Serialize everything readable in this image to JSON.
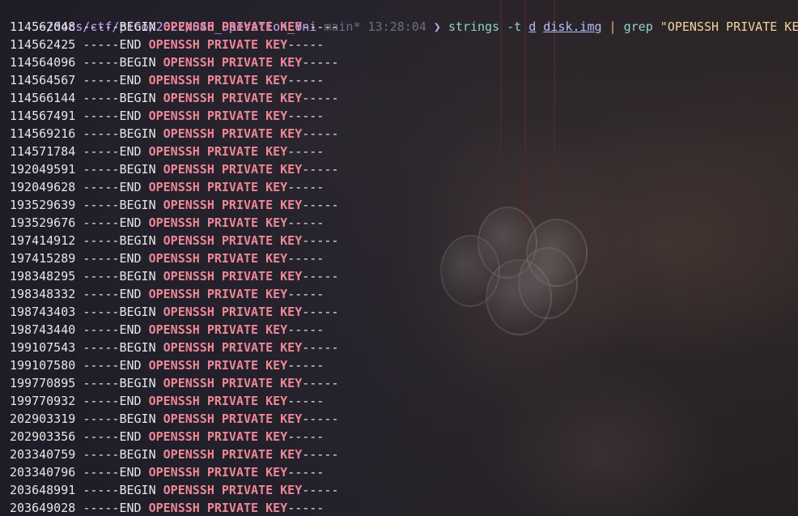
{
  "prompt": {
    "path": "~/docs/ctf/pico/2022/046_Operation_Oni",
    "branch": "main*",
    "time": "13:28:04",
    "chevron": "❯",
    "command": "strings",
    "flag": "-t",
    "flag_arg": "d",
    "file": "disk.img",
    "pipe": "|",
    "grep": "grep",
    "pattern": "\"OPENSSH PRIVATE KEY\""
  },
  "output": [
    {
      "offset": "114562048",
      "marker": "BEGIN"
    },
    {
      "offset": "114562425",
      "marker": "END"
    },
    {
      "offset": "114564096",
      "marker": "BEGIN"
    },
    {
      "offset": "114564567",
      "marker": "END"
    },
    {
      "offset": "114566144",
      "marker": "BEGIN"
    },
    {
      "offset": "114567491",
      "marker": "END"
    },
    {
      "offset": "114569216",
      "marker": "BEGIN"
    },
    {
      "offset": "114571784",
      "marker": "END"
    },
    {
      "offset": "192049591",
      "marker": "BEGIN"
    },
    {
      "offset": "192049628",
      "marker": "END"
    },
    {
      "offset": "193529639",
      "marker": "BEGIN"
    },
    {
      "offset": "193529676",
      "marker": "END"
    },
    {
      "offset": "197414912",
      "marker": "BEGIN"
    },
    {
      "offset": "197415289",
      "marker": "END"
    },
    {
      "offset": "198348295",
      "marker": "BEGIN"
    },
    {
      "offset": "198348332",
      "marker": "END"
    },
    {
      "offset": "198743403",
      "marker": "BEGIN"
    },
    {
      "offset": "198743440",
      "marker": "END"
    },
    {
      "offset": "199107543",
      "marker": "BEGIN"
    },
    {
      "offset": "199107580",
      "marker": "END"
    },
    {
      "offset": "199770895",
      "marker": "BEGIN"
    },
    {
      "offset": "199770932",
      "marker": "END"
    },
    {
      "offset": "202903319",
      "marker": "BEGIN"
    },
    {
      "offset": "202903356",
      "marker": "END"
    },
    {
      "offset": "203340759",
      "marker": "BEGIN"
    },
    {
      "offset": "203340796",
      "marker": "END"
    },
    {
      "offset": "203648991",
      "marker": "BEGIN"
    },
    {
      "offset": "203649028",
      "marker": "END"
    }
  ],
  "match_words": [
    "OPENSSH",
    "PRIVATE",
    "KEY"
  ],
  "dashes": "-----",
  "colors": {
    "match": "#ed8796",
    "path": "#c6a0f6",
    "command": "#8bd5ca",
    "string": "#eed49f",
    "pipe": "#f5a97f"
  }
}
